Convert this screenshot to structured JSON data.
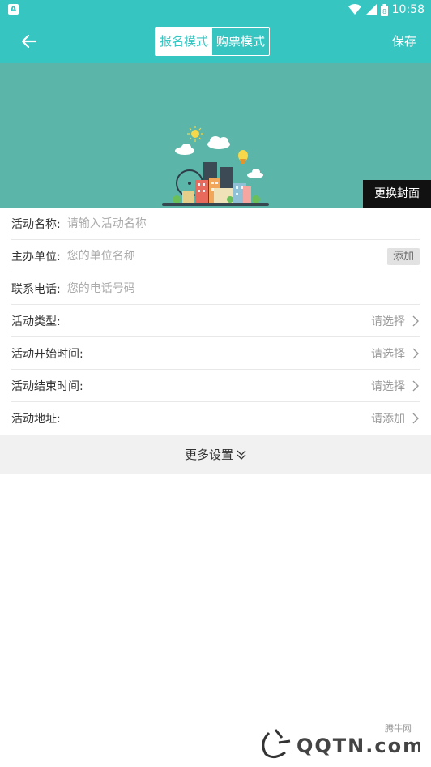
{
  "statusbar": {
    "time": "10:58",
    "app_icon_letter": "A",
    "battery_digit": "8"
  },
  "appbar": {
    "tabs": [
      {
        "label": "报名模式",
        "active": true
      },
      {
        "label": "购票模式",
        "active": false
      }
    ],
    "save_label": "保存"
  },
  "cover": {
    "change_label": "更换封面"
  },
  "form": {
    "name_label": "活动名称:",
    "name_placeholder": "请输入活动名称",
    "org_label": "主办单位:",
    "org_placeholder": "您的单位名称",
    "org_add_label": "添加",
    "phone_label": "联系电话:",
    "phone_placeholder": "您的电话号码",
    "type_label": "活动类型:",
    "type_value": "请选择",
    "start_label": "活动开始时间:",
    "start_value": "请选择",
    "end_label": "活动结束时间:",
    "end_value": "请选择",
    "address_label": "活动地址:",
    "address_value": "请添加"
  },
  "more_settings_label": "更多设置",
  "watermark": {
    "site": "腾牛网",
    "domain": "QQTN.com"
  },
  "colors": {
    "primary": "#37c5c2",
    "cover_bg": "#5bb5a8"
  }
}
